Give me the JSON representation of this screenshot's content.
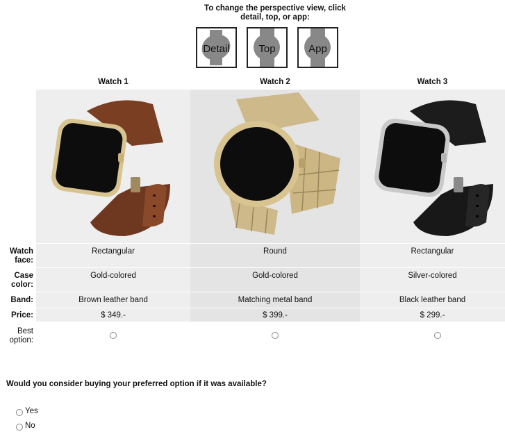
{
  "instruction": {
    "line1": "To change the perspective view, click",
    "line2": "detail, top, or app:"
  },
  "views": [
    {
      "label": "Detail",
      "icon": "watch-detail-icon"
    },
    {
      "label": "Top",
      "icon": "watch-top-icon"
    },
    {
      "label": "App",
      "icon": "watch-app-icon"
    }
  ],
  "columns": [
    {
      "title": "Watch 1",
      "face": "Rectangular",
      "case_color": "Gold-colored",
      "band": "Brown leather band",
      "price": "$ 349.-"
    },
    {
      "title": "Watch 2",
      "face": "Round",
      "case_color": "Gold-colored",
      "band": "Matching metal band",
      "price": "$ 399.-"
    },
    {
      "title": "Watch 3",
      "face": "Rectangular",
      "case_color": "Silver-colored",
      "band": "Black leather band",
      "price": "$ 299.-"
    }
  ],
  "row_labels": {
    "face_l1": "Watch",
    "face_l2": "face:",
    "case_l1": "Case",
    "case_l2": "color:",
    "band": "Band:",
    "price": "Price:",
    "best_l1": "Best",
    "best_l2": "option:"
  },
  "question": "Would you consider buying your preferred option if it was available?",
  "answers": [
    "Yes",
    "No"
  ],
  "colors": {
    "cell_bg_light": "#eeeeee",
    "cell_bg_dark": "#e4e4e4",
    "gold": "#d8c490",
    "brown_band": "#7a3e22",
    "black_band": "#1c1c1c",
    "icon_gray": "#888888"
  }
}
